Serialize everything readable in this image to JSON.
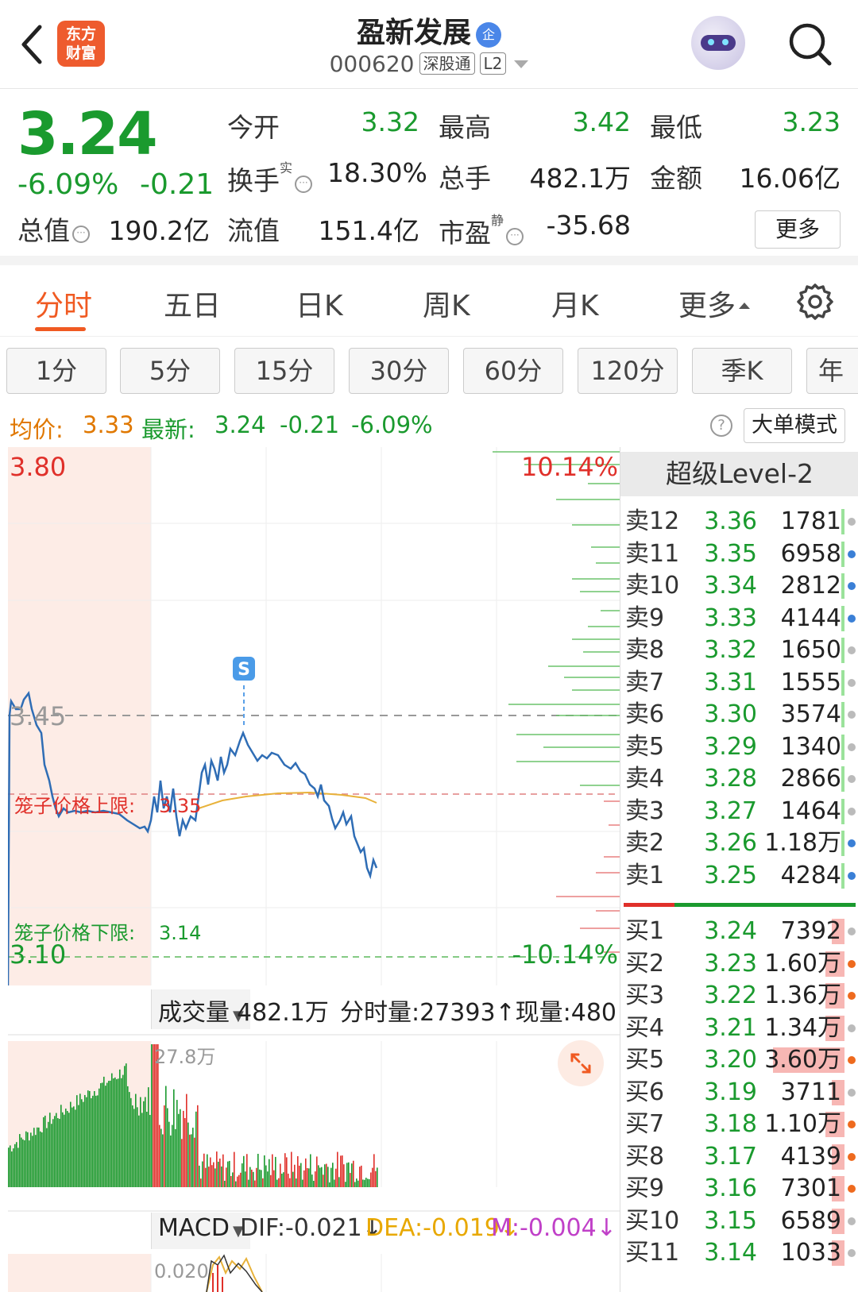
{
  "header": {
    "logo_line1": "东方",
    "logo_line2": "财富",
    "stock_name": "盈新发展",
    "name_badge": "企",
    "stock_code": "000620",
    "tag_connect": "深股通",
    "tag_level": "L2"
  },
  "quote": {
    "price": "3.24",
    "change_pct": "-6.09%",
    "change_abs": "-0.21",
    "open_label": "今开",
    "open_value": "3.32",
    "high_label": "最高",
    "high_value": "3.42",
    "low_label": "最低",
    "low_value": "3.23",
    "turnover_label": "换手",
    "turnover_sup": "实",
    "turnover_value": "18.30%",
    "volume_label": "总手",
    "volume_value": "482.1万",
    "amount_label": "金额",
    "amount_value": "16.06亿",
    "mktcap_label": "总值",
    "mktcap_value": "190.2亿",
    "float_label": "流值",
    "float_value": "151.4亿",
    "pe_label": "市盈",
    "pe_sup": "静",
    "pe_value": "-35.68",
    "more_button": "更多"
  },
  "tabs": [
    {
      "label": "分时",
      "active": true
    },
    {
      "label": "五日"
    },
    {
      "label": "日K"
    },
    {
      "label": "周K"
    },
    {
      "label": "月K"
    },
    {
      "label": "更多"
    }
  ],
  "periods": [
    "1分",
    "5分",
    "15分",
    "30分",
    "60分",
    "120分",
    "季K",
    "年"
  ],
  "infoline": {
    "avg_label": "均价:",
    "avg_value": "3.33",
    "latest_label": "最新:",
    "latest_value": "3.24",
    "latest_change": "-0.21",
    "latest_pct": "-6.09%",
    "mode_button": "大单模式"
  },
  "chart_labels": {
    "y_top": "3.80",
    "y_mid": "3.45",
    "y_bottom": "3.10",
    "pct_top": "10.14%",
    "pct_bottom": "-10.14%",
    "cage_upper": "笼子价格上限:",
    "cage_upper_value": "3.35",
    "cage_lower": "笼子价格下限:",
    "cage_lower_value": "3.14",
    "signal_marker": "S",
    "vol_peak_label": "27.8万",
    "macd_axis_label": "0.020"
  },
  "volume_bar": {
    "selector": "成交量",
    "total": "482.1万",
    "tick_label": "分时量:27393↑",
    "now_label": "现量:480"
  },
  "macd_bar": {
    "selector": "MACD",
    "dif": "DIF:-0.021↓",
    "dea": "DEA:-0.019↓",
    "m": "M:-0.004↓"
  },
  "level2": {
    "title": "超级Level-2",
    "sell": [
      {
        "label": "卖12",
        "price": "3.36",
        "vol": "1781",
        "dot": "gray"
      },
      {
        "label": "卖11",
        "price": "3.35",
        "vol": "6958",
        "dot": "blue"
      },
      {
        "label": "卖10",
        "price": "3.34",
        "vol": "2812",
        "dot": "blue"
      },
      {
        "label": "卖9",
        "price": "3.33",
        "vol": "4144",
        "dot": "blue"
      },
      {
        "label": "卖8",
        "price": "3.32",
        "vol": "1650",
        "dot": "gray"
      },
      {
        "label": "卖7",
        "price": "3.31",
        "vol": "1555",
        "dot": "gray"
      },
      {
        "label": "卖6",
        "price": "3.30",
        "vol": "3574",
        "dot": "gray"
      },
      {
        "label": "卖5",
        "price": "3.29",
        "vol": "1340",
        "dot": "gray"
      },
      {
        "label": "卖4",
        "price": "3.28",
        "vol": "2866",
        "dot": "gray"
      },
      {
        "label": "卖3",
        "price": "3.27",
        "vol": "1464",
        "dot": "gray"
      },
      {
        "label": "卖2",
        "price": "3.26",
        "vol": "1.18万",
        "dot": "blue"
      },
      {
        "label": "卖1",
        "price": "3.25",
        "vol": "4284",
        "dot": "blue"
      }
    ],
    "buy": [
      {
        "label": "买1",
        "price": "3.24",
        "vol": "7392",
        "dot": "gray"
      },
      {
        "label": "买2",
        "price": "3.23",
        "vol": "1.60万",
        "dot": "orange"
      },
      {
        "label": "买3",
        "price": "3.22",
        "vol": "1.36万",
        "dot": "orange"
      },
      {
        "label": "买4",
        "price": "3.21",
        "vol": "1.34万",
        "dot": "gray"
      },
      {
        "label": "买5",
        "price": "3.20",
        "vol": "3.60万",
        "dot": "orange"
      },
      {
        "label": "买6",
        "price": "3.19",
        "vol": "3711",
        "dot": "gray"
      },
      {
        "label": "买7",
        "price": "3.18",
        "vol": "1.10万",
        "dot": "orange"
      },
      {
        "label": "买8",
        "price": "3.17",
        "vol": "4139",
        "dot": "orange"
      },
      {
        "label": "买9",
        "price": "3.16",
        "vol": "7301",
        "dot": "orange"
      },
      {
        "label": "买10",
        "price": "3.15",
        "vol": "6589",
        "dot": "gray"
      },
      {
        "label": "买11",
        "price": "3.14",
        "vol": "1033",
        "dot": "gray"
      }
    ]
  },
  "colors": {
    "up": "#e0302a",
    "down": "#1a9a2e",
    "accent": "#f05a22",
    "price_line": "#2f6db5",
    "avg_line": "#e8b23a"
  }
}
